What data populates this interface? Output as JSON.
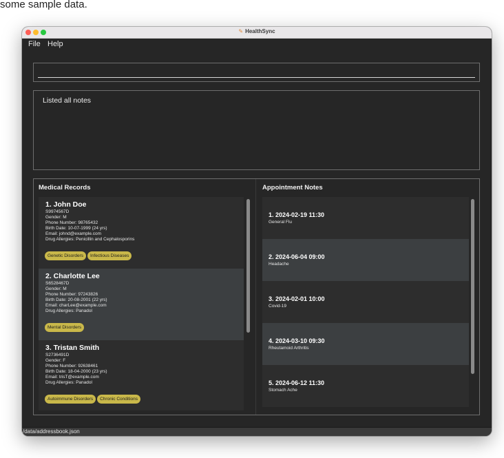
{
  "caption": "some sample data.",
  "window": {
    "title": "HealthSync"
  },
  "menu": [
    "File",
    "Help"
  ],
  "command": {
    "value": "",
    "placeholder": ""
  },
  "result": {
    "text": "Listed all notes"
  },
  "records": {
    "title": "Medical Records",
    "items": [
      {
        "name": "1.  John Doe",
        "nric": "S9974567D",
        "gender": "Gender: M",
        "phone": "Phone Number: 98765432",
        "birth": "Birth Date: 10-07-1999 (24 yrs)",
        "email": "Email: johnd@example.com",
        "allergies": "Drug Allergies: Penicillin and Cephalosporins",
        "tags": [
          "Genetic Disorders",
          "Infectious Diseases"
        ]
      },
      {
        "name": "2.  Charlotte Lee",
        "nric": "S6528467D",
        "gender": "Gender: M",
        "phone": "Phone Number: 97243826",
        "birth": "Birth Date: 20-08-2001 (22 yrs)",
        "email": "Email: charLee@example.com",
        "allergies": "Drug Allergies: Panadol",
        "tags": [
          "Mental Disorders"
        ]
      },
      {
        "name": "3.  Tristan Smith",
        "nric": "S2736491D",
        "gender": "Gender: F",
        "phone": "Phone Number: 92638461",
        "birth": "Birth Date: 18-04-2000 (23 yrs)",
        "email": "Email: trisT@example.com",
        "allergies": "Drug Allergies: Panadol",
        "tags": [
          "Autoimmune Disorders",
          "Chronic Conditions"
        ]
      }
    ]
  },
  "notes": {
    "title": "Appointment Notes",
    "items": [
      {
        "head": "1.  2024-02-19 11:30",
        "desc": "General Flu"
      },
      {
        "head": "2.  2024-06-04 09:00",
        "desc": "Headache"
      },
      {
        "head": "3.  2024-02-01 10:00",
        "desc": "Covid-19"
      },
      {
        "head": "4.  2024-03-10 09:30",
        "desc": "Rheutamoid Arthritis"
      },
      {
        "head": "5.  2024-06-12 11:30",
        "desc": "Stomach Ache"
      }
    ]
  },
  "status": {
    "path": "/data/addressbook.json"
  },
  "colors": {
    "window_bg": "#262626",
    "card_dark": "#2d2d2d",
    "card_light": "#3c3f41",
    "tag_bg": "#c9b84a",
    "border": "#6e6e6e"
  }
}
